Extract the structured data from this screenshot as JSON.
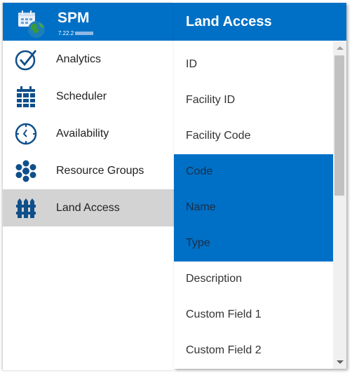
{
  "app": {
    "title": "SPM",
    "version": "7.22.2"
  },
  "sidebar": {
    "items": [
      {
        "label": "Analytics",
        "icon": "check-circle-icon",
        "active": false
      },
      {
        "label": "Scheduler",
        "icon": "calendar-icon",
        "active": false
      },
      {
        "label": "Availability",
        "icon": "clock-icon",
        "active": false
      },
      {
        "label": "Resource Groups",
        "icon": "hexagon-cluster-icon",
        "active": false
      },
      {
        "label": "Land Access",
        "icon": "fence-icon",
        "active": true
      }
    ]
  },
  "panel": {
    "title": "Land Access",
    "fields": [
      {
        "label": "ID",
        "selected": false
      },
      {
        "label": "Facility ID",
        "selected": false
      },
      {
        "label": "Facility Code",
        "selected": false
      },
      {
        "label": "Code",
        "selected": true
      },
      {
        "label": "Name",
        "selected": true
      },
      {
        "label": "Type",
        "selected": true
      },
      {
        "label": "Description",
        "selected": false
      },
      {
        "label": "Custom Field 1",
        "selected": false
      },
      {
        "label": "Custom Field 2",
        "selected": false
      }
    ]
  },
  "colors": {
    "brand": "#0070c6",
    "active_nav": "#d3d3d3",
    "icon": "#0f4f8a"
  }
}
